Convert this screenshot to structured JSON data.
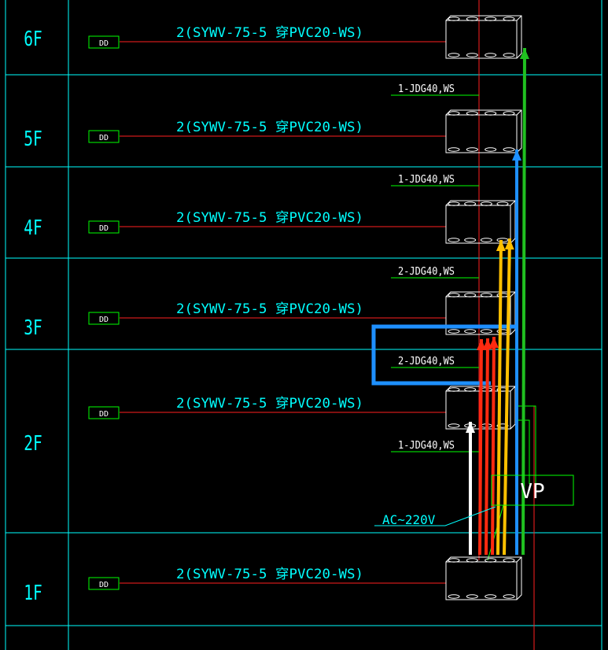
{
  "colors": {
    "background": "#000000",
    "grid": "#00ffff",
    "cable_text": "#00ffff",
    "trunk": "#ff2020",
    "green": "#00ff00",
    "box_outline": "#ffffff",
    "arrow_white": "#ffffff",
    "arrow_red": "#ff2a10",
    "arrow_orange": "#ffc000",
    "arrow_blue": "#1e90ff",
    "arrow_green": "#20c020"
  },
  "floors": [
    {
      "label": "6F",
      "outlet": "DD",
      "cable": "2(SYWV-75-5 穿PVC20-WS)"
    },
    {
      "label": "5F",
      "outlet": "DD",
      "cable": "2(SYWV-75-5 穿PVC20-WS)"
    },
    {
      "label": "4F",
      "outlet": "DD",
      "cable": "2(SYWV-75-5 穿PVC20-WS)"
    },
    {
      "label": "3F",
      "outlet": "DD",
      "cable": "2(SYWV-75-5 穿PVC20-WS)"
    },
    {
      "label": "2F",
      "outlet": "DD",
      "cable": "2(SYWV-75-5 穿PVC20-WS)"
    },
    {
      "label": "1F",
      "outlet": "DD",
      "cable": "2(SYWV-75-5 穿PVC20-WS)"
    }
  ],
  "conduits": [
    {
      "label": "1-JDG40,WS"
    },
    {
      "label": "1-JDG40,WS"
    },
    {
      "label": "2-JDG40,WS"
    },
    {
      "label": "2-JDG40,WS"
    },
    {
      "label": "1-JDG40,WS"
    }
  ],
  "vp_label": "VP",
  "power_label": "AC~220V"
}
